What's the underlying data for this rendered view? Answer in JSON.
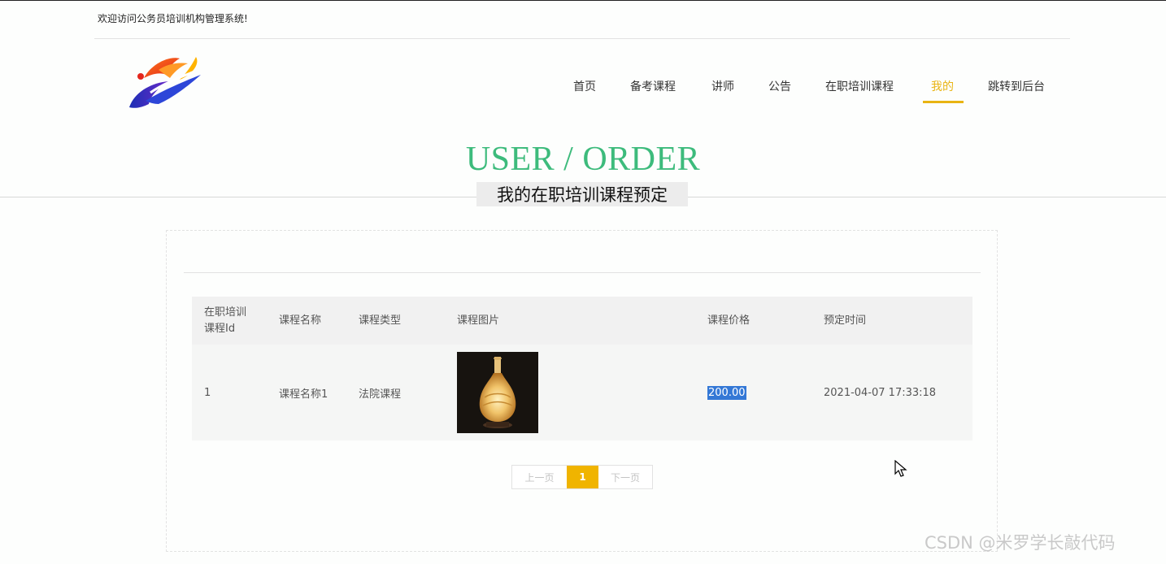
{
  "header": {
    "welcome_text": "欢迎访问公务员培训机构管理系统!"
  },
  "logo": {
    "icon": "brand-logo"
  },
  "nav": {
    "items": [
      {
        "label": "首页"
      },
      {
        "label": "备考课程"
      },
      {
        "label": "讲师"
      },
      {
        "label": "公告"
      },
      {
        "label": "在职培训课程"
      },
      {
        "label": "我的",
        "active": true
      },
      {
        "label": "跳转到后台"
      }
    ]
  },
  "section": {
    "title_en": "USER / ORDER",
    "title_cn": "我的在职培训课程预定"
  },
  "table": {
    "columns": [
      "在职培训课程Id",
      "课程名称",
      "课程类型",
      "课程图片",
      "课程价格",
      "预定时间"
    ],
    "column_lines": [
      [
        "在职培训",
        "课程Id"
      ]
    ],
    "rows": [
      {
        "id": "1",
        "name": "课程名称1",
        "type": "法院课程",
        "image": "porcelain-vase-lamp",
        "price": "200.00",
        "time": "2021-04-07 17:33:18"
      }
    ]
  },
  "pagination": {
    "prev": "上一页",
    "current": "1",
    "next": "下一页"
  },
  "watermark": "CSDN @米罗学长敲代码",
  "colors": {
    "accent": "#e9b413",
    "title_green": "#3dbb7c",
    "pager_active": "#f0b400",
    "selection": "#3478d6"
  }
}
